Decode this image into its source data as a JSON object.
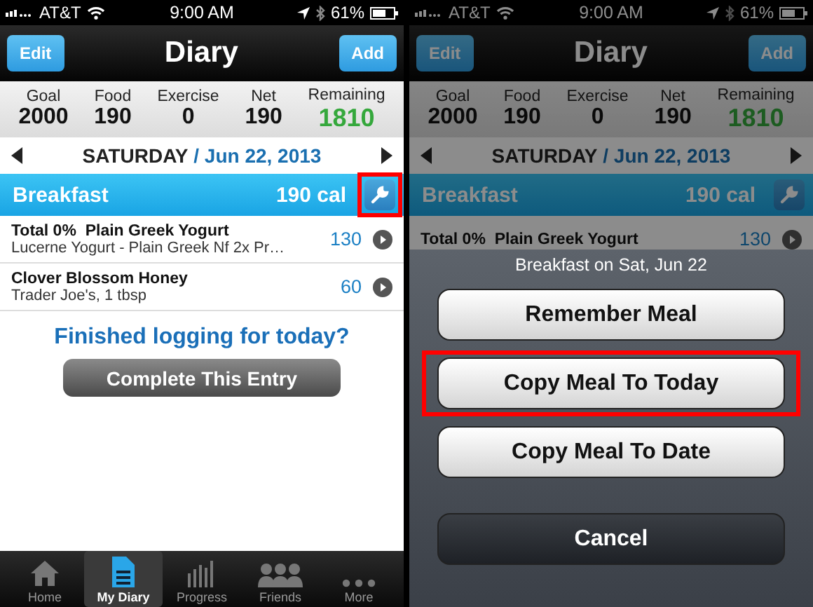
{
  "screens": [
    {
      "dimmed": false,
      "status_bar": {
        "carrier": "AT&T",
        "time": "9:00 AM",
        "battery": "61%"
      },
      "nav": {
        "title": "Diary",
        "left_button": "Edit",
        "right_button": "Add"
      },
      "summary": [
        {
          "label": "Goal",
          "value": "2000",
          "kind": "plain"
        },
        {
          "label": "Food",
          "value": "190",
          "kind": "plain"
        },
        {
          "label": "Exercise",
          "value": "0",
          "kind": "plain"
        },
        {
          "label": "Net",
          "value": "190",
          "kind": "plain"
        },
        {
          "label": "Remaining",
          "value": "1810",
          "kind": "positive"
        }
      ],
      "date": {
        "day": "SATURDAY",
        "date": "/ Jun 22, 2013"
      },
      "meal": {
        "name": "Breakfast",
        "calories": "190 cal",
        "tool_highlighted": true
      },
      "entries": [
        {
          "name": "Total 0%  Plain Greek Yogurt",
          "detail": "Lucerne Yogurt - Plain Greek Nf 2x Pr…",
          "calories": "130"
        },
        {
          "name": "Clover Blossom Honey",
          "detail": "Trader Joe's, 1 tbsp",
          "calories": "60"
        }
      ],
      "prompt": "Finished logging for today?",
      "complete_button": "Complete This Entry",
      "tabs": [
        {
          "label": "Home",
          "kind": "home",
          "selected": false
        },
        {
          "label": "My Diary",
          "kind": "diary",
          "selected": true
        },
        {
          "label": "Progress",
          "kind": "progress",
          "selected": false
        },
        {
          "label": "Friends",
          "kind": "friends",
          "selected": false
        },
        {
          "label": "More",
          "kind": "more",
          "selected": false
        }
      ]
    },
    {
      "dimmed": true,
      "status_bar": {
        "carrier": "AT&T",
        "time": "9:00 AM",
        "battery": "61%"
      },
      "nav": {
        "title": "Diary",
        "left_button": "Edit",
        "right_button": "Add"
      },
      "summary": [
        {
          "label": "Goal",
          "value": "2000",
          "kind": "plain"
        },
        {
          "label": "Food",
          "value": "190",
          "kind": "plain"
        },
        {
          "label": "Exercise",
          "value": "0",
          "kind": "plain"
        },
        {
          "label": "Net",
          "value": "190",
          "kind": "plain"
        },
        {
          "label": "Remaining",
          "value": "1810",
          "kind": "positive"
        }
      ],
      "date": {
        "day": "SATURDAY",
        "date": "/ Jun 22, 2013"
      },
      "meal": {
        "name": "Breakfast",
        "calories": "190 cal",
        "tool_highlighted": false
      },
      "entries": [
        {
          "name": "Total 0%  Plain Greek Yogurt",
          "calories": "130"
        }
      ],
      "action_sheet": {
        "title": "Breakfast on Sat, Jun 22",
        "buttons": [
          {
            "label": "Remember Meal",
            "kind": "option",
            "highlighted": false
          },
          {
            "label": "Copy Meal To Today",
            "kind": "option",
            "highlighted": true
          },
          {
            "label": "Copy Meal To Date",
            "kind": "option",
            "highlighted": false
          },
          {
            "label": "Cancel",
            "kind": "cancel",
            "highlighted": false
          }
        ]
      }
    }
  ]
}
